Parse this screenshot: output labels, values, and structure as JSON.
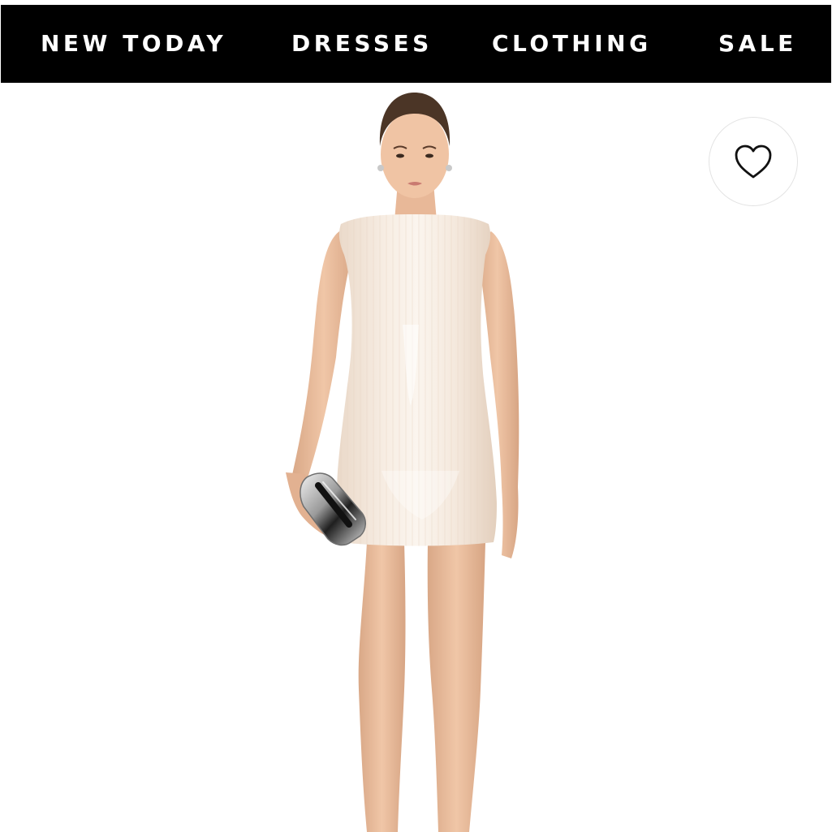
{
  "nav": {
    "items": [
      {
        "label": "NEW TODAY"
      },
      {
        "label": "DRESSES"
      },
      {
        "label": "CLOTHING"
      },
      {
        "label": "SALE"
      }
    ]
  },
  "wishlist": {
    "icon": "heart-outline-icon"
  },
  "colors": {
    "nav_background": "#000000",
    "nav_text": "#ffffff",
    "page_background": "#ffffff"
  }
}
